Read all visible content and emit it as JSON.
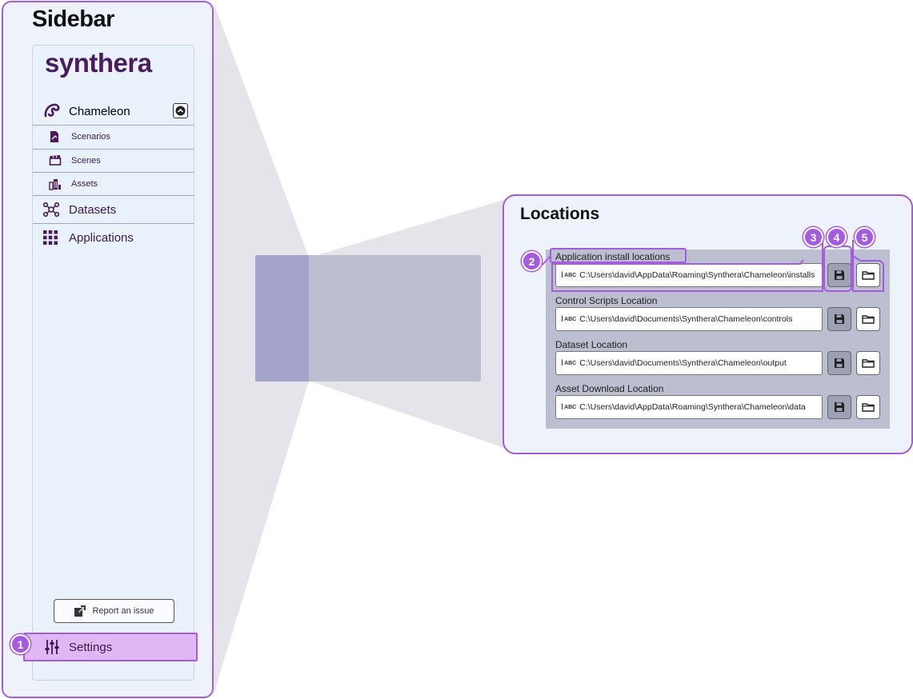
{
  "sidebar_callout": {
    "title": "Sidebar",
    "logo": "synthera",
    "nav": {
      "chameleon": {
        "label": "Chameleon",
        "icon": "chameleon-icon"
      },
      "sub_items": [
        {
          "label": "Scenarios",
          "icon": "document-icon"
        },
        {
          "label": "Scenes",
          "icon": "clapperboard-icon"
        },
        {
          "label": "Assets",
          "icon": "buildings-icon"
        }
      ],
      "datasets": {
        "label": "Datasets",
        "icon": "network-icon"
      },
      "applications": {
        "label": "Applications",
        "icon": "grid-icon"
      }
    },
    "report_button": "Report an issue",
    "settings": {
      "label": "Settings",
      "icon": "sliders-icon"
    },
    "badge": "1"
  },
  "locations_callout": {
    "title": "Locations",
    "fields": [
      {
        "label": "Application install locations",
        "value": "C:\\Users\\david\\AppData\\Roaming\\Synthera\\Chameleon\\installs"
      },
      {
        "label": "Control Scripts Location",
        "value": "C:\\Users\\david\\Documents\\Synthera\\Chameleon\\controls"
      },
      {
        "label": "Dataset Location",
        "value": "C:\\Users\\david\\Documents\\Synthera\\Chameleon\\output"
      },
      {
        "label": "Asset Download Location",
        "value": "C:\\Users\\david\\AppData\\Roaming\\Synthera\\Chameleon\\data"
      }
    ],
    "field_icon_text": "ABC",
    "badges": [
      "2",
      "3",
      "4",
      "5"
    ]
  },
  "colors": {
    "accent": "#a55be0",
    "settings_highlight": "#e1b7f3",
    "brand_text": "#4b1b5f",
    "panel_bg": "#bbbfd0"
  }
}
